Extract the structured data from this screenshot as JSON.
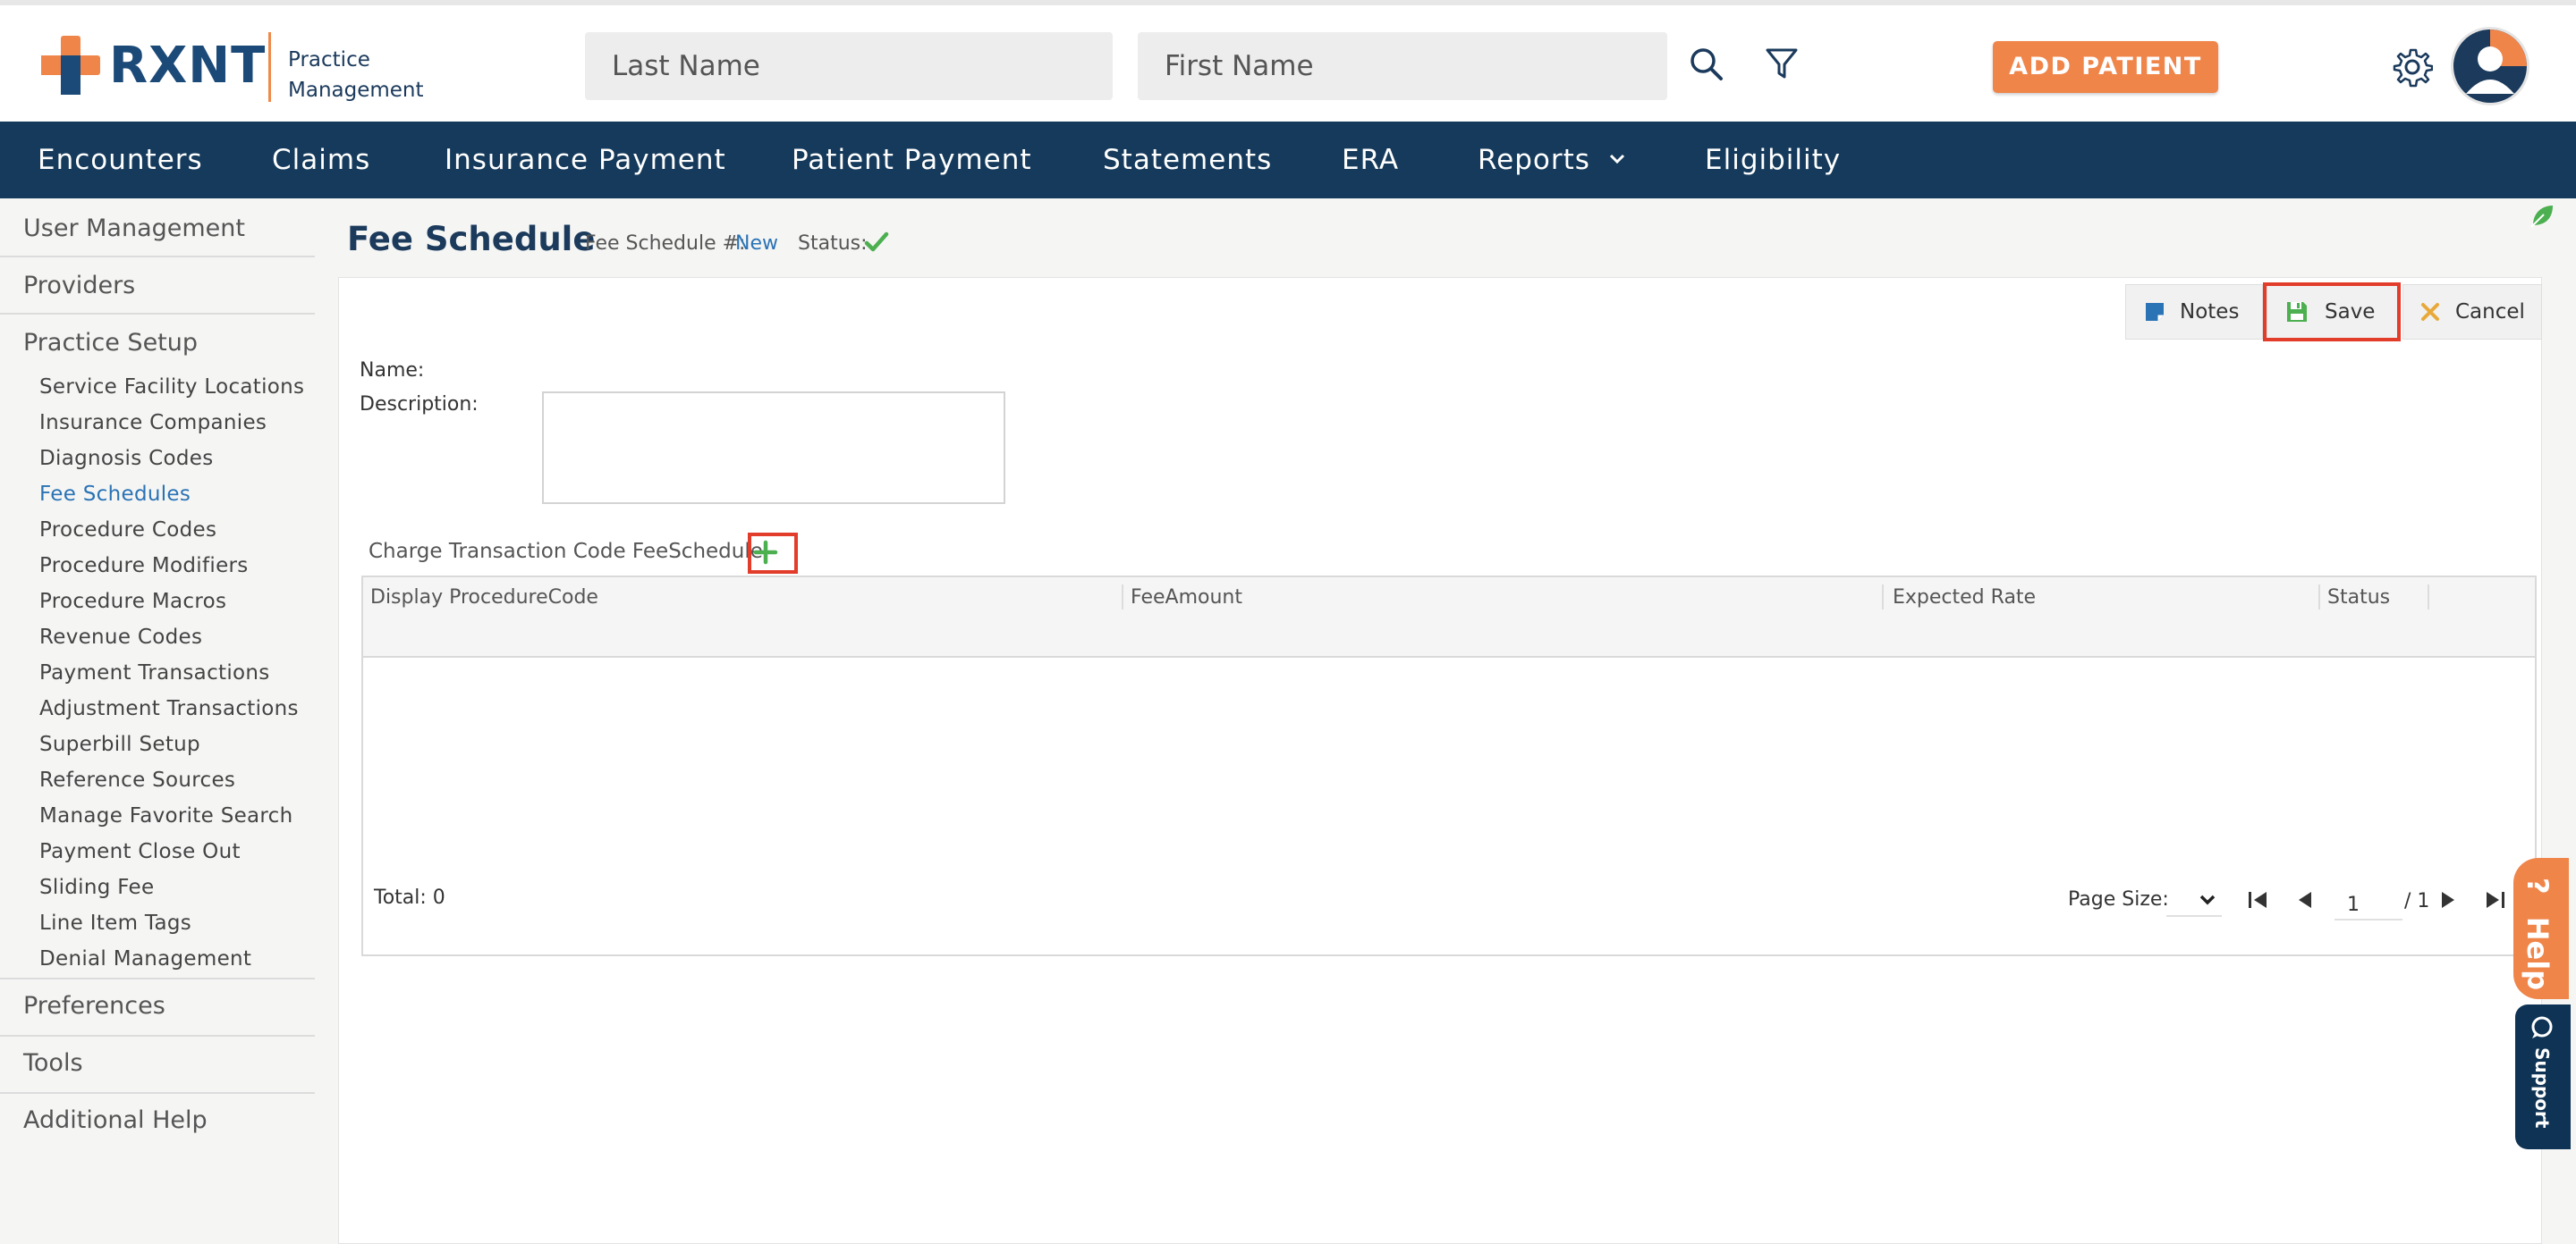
{
  "app": {
    "logo_text": "RXNT",
    "logo_sub_line1": "Practice",
    "logo_sub_line2": "Management"
  },
  "header": {
    "last_name_placeholder": "Last Name",
    "first_name_placeholder": "First Name",
    "add_patient_label": "ADD PATIENT"
  },
  "nav": {
    "items": [
      "Encounters",
      "Claims",
      "Insurance Payment",
      "Patient Payment",
      "Statements",
      "ERA",
      "Reports",
      "Eligibility"
    ]
  },
  "sidebar": {
    "user_management": "User Management",
    "providers": "Providers",
    "practice_setup": "Practice Setup",
    "sub_items": [
      "Service Facility Locations",
      "Insurance Companies",
      "Diagnosis Codes",
      "Fee Schedules",
      "Procedure Codes",
      "Procedure Modifiers",
      "Procedure Macros",
      "Revenue Codes",
      "Payment Transactions",
      "Adjustment Transactions",
      "Superbill Setup",
      "Reference Sources",
      "Manage Favorite Search",
      "Payment Close Out",
      "Sliding Fee",
      "Line Item Tags",
      "Denial Management"
    ],
    "active_sub_item": "Fee Schedules",
    "preferences": "Preferences",
    "tools": "Tools",
    "additional_help": "Additional Help"
  },
  "page": {
    "title": "Fee Schedule",
    "fee_schedule_no_label": "Fee Schedule #:",
    "fee_schedule_no_value": "New",
    "status_label": "Status:"
  },
  "toolbar": {
    "notes_label": "Notes",
    "save_label": "Save",
    "cancel_label": "Cancel"
  },
  "form": {
    "name_label": "Name:",
    "description_label": "Description:",
    "description_value": "",
    "charge_section_label": "Charge Transaction Code FeeSchedule:"
  },
  "grid": {
    "columns": [
      "Display ProcedureCode",
      "FeeAmount",
      "Expected Rate",
      "Status"
    ],
    "rows": [],
    "total_label": "Total: 0",
    "page_size_label": "Page Size:",
    "current_page": "1",
    "page_count": "/ 1"
  },
  "side_tabs": {
    "help_label": "Help",
    "help_glyph": "?",
    "support_label": "Support"
  },
  "colors": {
    "brand_navy": "#153a5b",
    "brand_orange": "#f0854a",
    "link_blue": "#2a73b5",
    "success_green": "#4caf50",
    "highlight_red": "#e23c2b"
  }
}
